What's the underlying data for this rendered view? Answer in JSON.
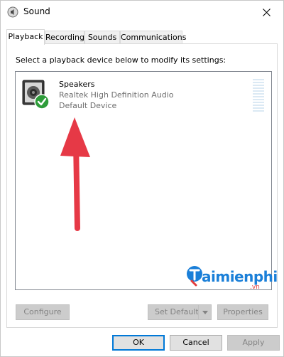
{
  "window": {
    "title": "Sound"
  },
  "tabs": [
    {
      "label": "Playback",
      "active": true
    },
    {
      "label": "Recording",
      "active": false
    },
    {
      "label": "Sounds",
      "active": false
    },
    {
      "label": "Communications",
      "active": false
    }
  ],
  "playback": {
    "instruction": "Select a playback device below to modify its settings:",
    "devices": [
      {
        "name": "Speakers",
        "driver": "Realtek High Definition Audio",
        "status": "Default Device",
        "icon": "speaker-icon",
        "badge": "default-check-icon",
        "level": 0
      }
    ],
    "buttons": {
      "configure": "Configure",
      "set_default": "Set Default",
      "properties": "Properties"
    }
  },
  "dialog_buttons": {
    "ok": "OK",
    "cancel": "Cancel",
    "apply": "Apply"
  },
  "watermark": {
    "brand": "aimienphi",
    "suffix": ".vn"
  },
  "colors": {
    "accent": "#0078d7",
    "check_badge": "#2e9c3a",
    "annotation_arrow": "#e63946",
    "level_meter": "#dbe9f4"
  }
}
